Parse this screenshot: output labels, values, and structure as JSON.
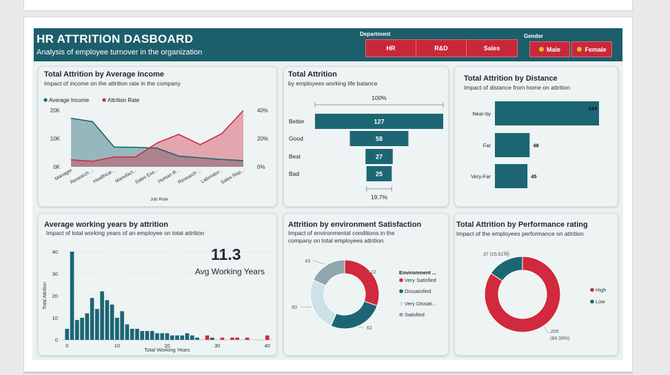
{
  "header": {
    "title": "HR ATTRITION DASBOARD",
    "subtitle": "Analysis of employee turnover in the organization"
  },
  "filters": {
    "department": {
      "label": "Department",
      "options": [
        "HR",
        "R&D",
        "Sales"
      ]
    },
    "gender": {
      "label": "Gender",
      "options": [
        {
          "label": "Male",
          "icon": "male-icon"
        },
        {
          "label": "Female",
          "icon": "female-icon"
        }
      ]
    }
  },
  "colors": {
    "teal": "#1c6673",
    "red": "#d1293e",
    "header": "#1c5e6b",
    "light_teal": "#8fa6ac",
    "very_light": "#cde2e6"
  },
  "income_card": {
    "title": "Total Attrition by Average Income",
    "subtitle": "Impact of income on the attrition rate in the company"
  },
  "funnel_card": {
    "title": "Total Attrition",
    "subtitle": "by employees working life balance"
  },
  "distance_card": {
    "title": "Total Attrition by Distance",
    "subtitle": "Impact of distance from home on attrition"
  },
  "years_card": {
    "title": "Average working years by attrition",
    "subtitle": "Impact of total working years of an employee on total attrition",
    "kpi_value": "11.3",
    "kpi_label": "Avg Working Years"
  },
  "env_card": {
    "title": "Attrition by environment Satisfaction",
    "subtitle_line1": "Impact of environmental conditions in the",
    "subtitle_line2": "company on total employees attrition"
  },
  "perf_card": {
    "title": "Total Attrition by Performance rating",
    "subtitle": "Impact of the employees performance on attrition"
  },
  "chart_data": [
    {
      "type": "area",
      "title": "Total Attrition by Average Income",
      "xlabel": "Job Role",
      "ylabel": "",
      "categories": [
        "Manager",
        "Research ...",
        "Healthcar...",
        "Manufact...",
        "Sales Exe...",
        "Human R...",
        "Research ...",
        "Laborator...",
        "Sales Rep..."
      ],
      "y_ticks": [
        "0K",
        "10K",
        "20K"
      ],
      "y2_ticks": [
        "0%",
        "20%",
        "40%"
      ],
      "ylim": [
        0,
        20000
      ],
      "y2lim": [
        0,
        40
      ],
      "series": [
        {
          "name": "Average Income",
          "axis": "left",
          "values": [
            17200,
            16000,
            7000,
            6900,
            6600,
            3800,
            3200,
            2600,
            2200
          ]
        },
        {
          "name": "Attrition Rate",
          "axis": "right",
          "values": [
            5,
            3.9,
            7,
            7,
            16.9,
            23,
            15.7,
            23.5,
            39.8
          ]
        }
      ],
      "legend": "top-left"
    },
    {
      "type": "bar",
      "orientation": "horizontal",
      "title": "Total Attrition",
      "subtitle": "by employees working life balance",
      "categories": [
        "Better",
        "Good",
        "Best",
        "Bad"
      ],
      "values": [
        127,
        58,
        27,
        25
      ],
      "top_label": "100%",
      "bottom_label": "19.7%"
    },
    {
      "type": "bar",
      "orientation": "horizontal",
      "title": "Total Attrition by Distance",
      "categories": [
        "Near-by",
        "Far",
        "Very-Far"
      ],
      "values": [
        144,
        48,
        45
      ]
    },
    {
      "type": "bar",
      "title": "Average working years by attrition",
      "xlabel": "Total Working Years",
      "ylabel": "Total Attrition",
      "xlim": [
        -1,
        41
      ],
      "ylim": [
        0,
        40
      ],
      "x_ticks": [
        0,
        10,
        20,
        30,
        40
      ],
      "y_ticks": [
        0,
        10,
        20,
        30,
        40
      ],
      "x": [
        0,
        1,
        2,
        3,
        4,
        5,
        6,
        7,
        8,
        9,
        10,
        11,
        12,
        13,
        14,
        15,
        16,
        17,
        18,
        19,
        20,
        21,
        22,
        23,
        24,
        25,
        26,
        28,
        29,
        31,
        33,
        34,
        36,
        40
      ],
      "values": [
        5,
        40,
        9,
        10,
        12,
        19,
        14,
        22,
        18,
        16,
        10,
        13,
        7,
        5,
        5,
        4,
        4,
        4,
        3,
        3,
        3,
        2,
        2,
        2,
        3,
        2,
        1,
        2,
        1,
        1,
        1,
        1,
        1,
        2
      ],
      "highlight_x": [
        28,
        31,
        33,
        34,
        36,
        40
      ]
    },
    {
      "type": "pie",
      "hole": true,
      "title": "Attrition by environment Satisfaction",
      "legend_title": "Environment ...",
      "labels": [
        "Very Satisfied",
        "Dissatisfied",
        "Very Dissati...",
        "Satisfied"
      ],
      "values": [
        72,
        62,
        60,
        43
      ],
      "colors": [
        "#d1293e",
        "#1c6673",
        "#cde2e6",
        "#8fa6ac"
      ]
    },
    {
      "type": "pie",
      "hole": true,
      "title": "Total Attrition by Performance rating",
      "labels": [
        "High",
        "Low"
      ],
      "values": [
        200,
        37
      ],
      "percent_labels": [
        "200 (84.39%)",
        "37 (15.61%)"
      ],
      "colors": [
        "#d1293e",
        "#1c6673"
      ]
    }
  ]
}
